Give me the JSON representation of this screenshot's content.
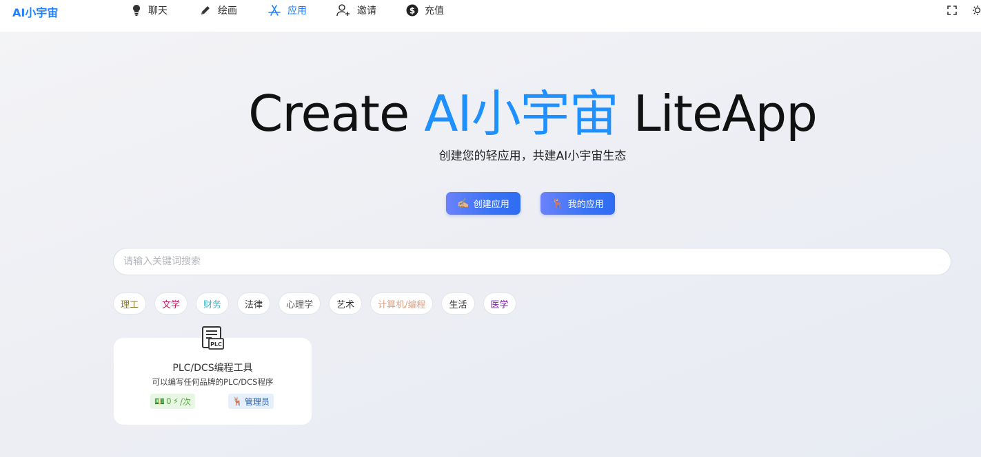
{
  "brand": {
    "title": "AI小宇宙"
  },
  "nav": {
    "items": [
      {
        "label": "聊天",
        "icon": "bulb-icon"
      },
      {
        "label": "绘画",
        "icon": "pencil-icon"
      },
      {
        "label": "应用",
        "icon": "app-store-icon",
        "active": true
      },
      {
        "label": "邀请",
        "icon": "add-user-icon"
      },
      {
        "label": "充值",
        "icon": "dollar-icon"
      }
    ],
    "right_icons": [
      "fullscreen-icon",
      "sun-icon"
    ]
  },
  "hero": {
    "title_pre": "Create ",
    "title_accent": "AI小宇宙",
    "title_post": " LiteApp",
    "subtitle": "创建您的轻应用，共建AI小宇宙生态",
    "create_button": {
      "emoji": "✍🏼",
      "label": "创建应用"
    },
    "my_apps_button": {
      "emoji": "🦌",
      "label": "我的应用"
    }
  },
  "search": {
    "placeholder": "请输入关键词搜索",
    "value": ""
  },
  "tags": [
    {
      "label": "理工",
      "color": "#8a7a2a"
    },
    {
      "label": "文学",
      "color": "#c2185b"
    },
    {
      "label": "财务",
      "color": "#3fb6c9"
    },
    {
      "label": "法律",
      "color": "#333333"
    },
    {
      "label": "心理学",
      "color": "#555555"
    },
    {
      "label": "艺术",
      "color": "#333333"
    },
    {
      "label": "计算机/编程",
      "color": "#e0a080"
    },
    {
      "label": "生活",
      "color": "#333333"
    },
    {
      "label": "医学",
      "color": "#7b1fa2"
    }
  ],
  "apps": [
    {
      "icon": "plc-document-icon",
      "icon_text": "PLC",
      "title": "PLC/DCS编程工具",
      "description": "可以编写任何品牌的PLC/DCS程序",
      "price_emoji": "💵",
      "price_value": "0",
      "price_unit_emoji": "⚡",
      "price_unit": "/次",
      "author_emoji": "🦌",
      "author": "管理员"
    }
  ],
  "colors": {
    "accent": "#1e80ff",
    "title_accent": "#1e90ff"
  }
}
